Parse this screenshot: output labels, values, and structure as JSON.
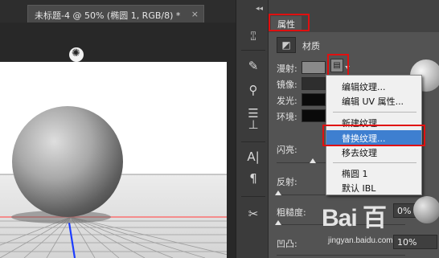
{
  "document": {
    "tab_title": "未标题-4 @ 50% (椭圆 1, RGB/8) *",
    "close_glyph": "×"
  },
  "toolstrip": {
    "collapse_glyph": "◂◂",
    "tools": [
      {
        "icon": "3d-panel-icon",
        "glyph": "⑄"
      },
      {
        "icon": "brush-presets-icon",
        "glyph": "✎"
      },
      {
        "icon": "brush-settings-icon",
        "glyph": "⚲"
      },
      {
        "icon": "adjustment-sliders-icon",
        "glyph": "☰"
      },
      {
        "icon": "clone-stamp-icon",
        "glyph": "⊥"
      },
      {
        "icon": "character-icon",
        "glyph": "A|"
      },
      {
        "icon": "paragraph-icon",
        "glyph": "¶"
      },
      {
        "icon": "tools-preset-icon",
        "glyph": "✂"
      }
    ]
  },
  "panel": {
    "tab_label": "属性",
    "material_label": "材质",
    "properties": [
      {
        "label": "漫射:",
        "color": "#8a8a8a"
      },
      {
        "label": "镜像:",
        "color": "#2e2e2e"
      },
      {
        "label": "发光:",
        "color": "#0a0a0a"
      },
      {
        "label": "环境:",
        "color": "#0a0a0a"
      }
    ],
    "sliders": [
      {
        "label": "闪亮:",
        "value": null
      },
      {
        "label": "反射:",
        "value": null
      },
      {
        "label": "粗糙度:",
        "value": "0%"
      },
      {
        "label": "凹凸:",
        "value": "10%"
      }
    ]
  },
  "context_menu": {
    "items": [
      {
        "label": "编辑纹理..."
      },
      {
        "label": "编辑 UV 属性..."
      },
      {
        "label": "新建纹理..."
      },
      {
        "label": "替换纹理...",
        "active": true
      },
      {
        "label": "移去纹理"
      },
      {
        "label": "椭圆 1"
      },
      {
        "label": "默认 IBL"
      }
    ]
  },
  "watermark": {
    "brand": "Bai 百",
    "url": "jingyan.baidu.com"
  },
  "colors": {
    "highlight_red": "#e01010",
    "menu_active_blue": "#3e7fd0",
    "ground_line_red": "#ff5a5a",
    "axis_blue": "#1c3cff"
  }
}
